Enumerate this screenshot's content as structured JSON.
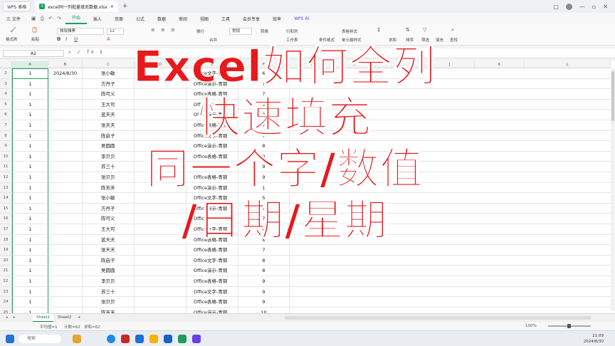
{
  "titlebar": {
    "app_name": "WPS 表格",
    "file_tab": "excel同一列批量填充数据.xlsx",
    "close_tab": "×",
    "new_tab": "+"
  },
  "menu": {
    "file": "三 文件",
    "items": [
      "开始",
      "插入",
      "页面",
      "公式",
      "数据",
      "审阅",
      "视图",
      "工具",
      "会员专享",
      "效率"
    ],
    "active": "开始",
    "wps_ai": "WPS AI"
  },
  "ribbon": {
    "format_painter": "格式刷",
    "paste": "粘贴",
    "font_name": "微软雅黑",
    "font_size": "12",
    "number_format": "常规",
    "convert": "转换",
    "rows_cols": "行和列",
    "workbook": "工作表",
    "cond_format": "条件格式",
    "cell_style": "单元格样式",
    "table_style": "表格样式",
    "sum": "求和",
    "filter": "筛选",
    "sort": "排序",
    "fill": "填充",
    "find": "查找",
    "wrap": "换行",
    "merge": "合并"
  },
  "formula_bar": {
    "cell_ref": "A2",
    "value": "1"
  },
  "columns": [
    "A",
    "B",
    "C",
    "D",
    "E",
    "F",
    "G",
    "H",
    "I",
    "J",
    "K",
    "L"
  ],
  "rows": [
    {
      "n": "2",
      "a": "1",
      "b": "2024/8/30",
      "c": "张小敏",
      "e": "Office文字-青铜",
      "f": "6"
    },
    {
      "n": "3",
      "a": "1",
      "b": "",
      "c": "方丹子",
      "e": "Office演示-青铜",
      "f": "7"
    },
    {
      "n": "4",
      "a": "1",
      "b": "",
      "c": "陈可义",
      "e": "Office表格-青铜",
      "f": "7"
    },
    {
      "n": "5",
      "a": "1",
      "b": "",
      "c": "王大可",
      "e": "Office文字-青铜",
      "f": "8"
    },
    {
      "n": "6",
      "a": "1",
      "b": "",
      "c": "蓝天天",
      "e": "Office演示-青铜",
      "f": "8"
    },
    {
      "n": "7",
      "a": "1",
      "b": "",
      "c": "张天天",
      "e": "Office表格-青铜",
      "f": "7"
    },
    {
      "n": "8",
      "a": "1",
      "b": "",
      "c": "陈启子",
      "e": "Office文字-青铜",
      "f": "7"
    },
    {
      "n": "9",
      "a": "1",
      "b": "",
      "c": "吴圆圆",
      "e": "Office演示-青铜",
      "f": "8"
    },
    {
      "n": "10",
      "a": "1",
      "b": "",
      "c": "李贝贝",
      "e": "Office表格-青铜",
      "f": "9"
    },
    {
      "n": "11",
      "a": "1",
      "b": "",
      "c": "苏三十",
      "e": "Office文字-青铜",
      "f": "9"
    },
    {
      "n": "12",
      "a": "1",
      "b": "",
      "c": "张贝贝",
      "e": "Office表格-青铜",
      "f": "9"
    },
    {
      "n": "13",
      "a": "1",
      "b": "",
      "c": "陈芳芳",
      "e": "Office演示-青铜",
      "f": "1"
    },
    {
      "n": "14",
      "a": "1",
      "b": "",
      "c": "张小敏",
      "e": "Office文字-青铜",
      "f": "5"
    },
    {
      "n": "15",
      "a": "1",
      "b": "",
      "c": "方丹子",
      "e": "Office演示-青铜",
      "f": "7"
    },
    {
      "n": "16",
      "a": "1",
      "b": "",
      "c": "陈可义",
      "e": "Office表格-青铜",
      "f": "7"
    },
    {
      "n": "17",
      "a": "1",
      "b": "",
      "c": "王大可",
      "e": "Office文字-青铜",
      "f": "8"
    },
    {
      "n": "18",
      "a": "1",
      "b": "",
      "c": "蓝天天",
      "e": "Office表格-青铜",
      "f": "8"
    },
    {
      "n": "19",
      "a": "1",
      "b": "",
      "c": "张天天",
      "e": "Office表格-青铜",
      "f": "7"
    },
    {
      "n": "20",
      "a": "1",
      "b": "",
      "c": "陈启子",
      "e": "Office文字-青铜",
      "f": "8"
    },
    {
      "n": "21",
      "a": "1",
      "b": "",
      "c": "吴圆圆",
      "e": "Office演示-青铜",
      "f": "8"
    },
    {
      "n": "22",
      "a": "1",
      "b": "",
      "c": "李贝贝",
      "e": "Office表格-青铜",
      "f": "9"
    },
    {
      "n": "23",
      "a": "1",
      "b": "",
      "c": "苏三十",
      "e": "Office文字-青铜",
      "f": "9"
    },
    {
      "n": "24",
      "a": "1",
      "b": "",
      "c": "张贝贝",
      "e": "Office表格-青铜",
      "f": "9"
    },
    {
      "n": "25",
      "a": "1",
      "b": "",
      "c": "陈芳芳",
      "e": "Office演示-青铜",
      "f": "10"
    }
  ],
  "sheets": [
    "Sheet1",
    "Sheet2"
  ],
  "add_sheet": "+",
  "status": {
    "average": "平均值=1",
    "count": "计数=62",
    "sum": "求和=62",
    "zoom": "100%"
  },
  "taskbar": {
    "search_placeholder": "搜索",
    "time": "21:09",
    "date": "2024/8/30"
  },
  "overlay": {
    "line1": "Excel如何全列",
    "line2": "快速填充",
    "line3": "同一个字/数值",
    "line4": "/日期/星期"
  },
  "colors": {
    "accent": "#1aa260",
    "overlay_text": "#e8191c",
    "selection": "#2b9a5a"
  }
}
